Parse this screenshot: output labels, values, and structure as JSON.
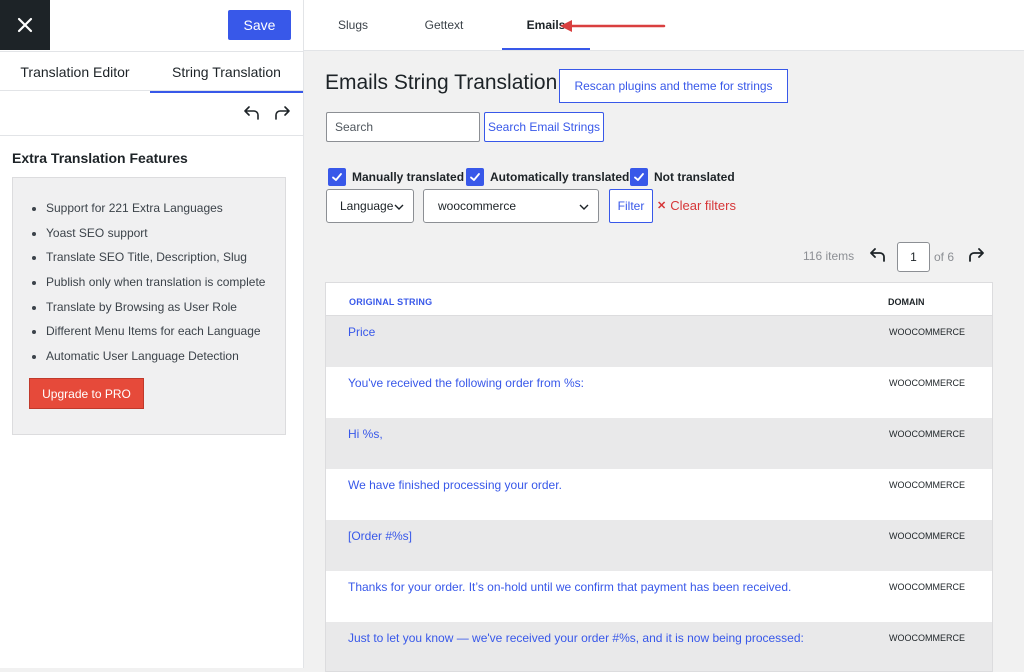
{
  "sidebar": {
    "save_label": "Save",
    "tabs": [
      {
        "label": "Translation Editor",
        "active": false
      },
      {
        "label": "String Translation",
        "active": true
      }
    ],
    "features_title": "Extra Translation Features",
    "features": [
      "Support for 221 Extra Languages",
      "Yoast SEO support",
      "Translate SEO Title, Description, Slug",
      "Publish only when translation is complete",
      "Translate by Browsing as User Role",
      "Different Menu Items for each Language",
      "Automatic User Language Detection"
    ],
    "upgrade_label": "Upgrade to PRO"
  },
  "topbar": {
    "tabs": [
      {
        "label": "Slugs",
        "active": false
      },
      {
        "label": "Gettext",
        "active": false
      },
      {
        "label": "Emails",
        "active": true
      }
    ]
  },
  "main": {
    "title": "Emails String Translation",
    "rescan_label": "Rescan plugins and theme for strings",
    "search_placeholder": "Search",
    "search_button": "Search Email Strings",
    "checkboxes": [
      {
        "label": "Manually translated",
        "checked": true
      },
      {
        "label": "Automatically translated",
        "checked": true
      },
      {
        "label": "Not translated",
        "checked": true
      }
    ],
    "language_select": "Language",
    "domain_select": "woocommerce",
    "filter_label": "Filter",
    "clear_filters": "Clear filters",
    "items_count": "116 items",
    "page_current": "1",
    "page_of": "of 6"
  },
  "table": {
    "headers": {
      "original": "ORIGINAL STRING",
      "domain": "DOMAIN"
    },
    "rows": [
      {
        "original": "Price",
        "domain": "WOOCOMMERCE"
      },
      {
        "original": "You've received the following order from %s:",
        "domain": "WOOCOMMERCE"
      },
      {
        "original": "Hi %s,",
        "domain": "WOOCOMMERCE"
      },
      {
        "original": "We have finished processing your order.",
        "domain": "WOOCOMMERCE"
      },
      {
        "original": "[Order #%s]",
        "domain": "WOOCOMMERCE"
      },
      {
        "original": "Thanks for your order. It’s on-hold until we confirm that payment has been received.",
        "domain": "WOOCOMMERCE"
      },
      {
        "original": "Just to let you know — we've received your order #%s, and it is now being processed:",
        "domain": "WOOCOMMERCE"
      }
    ]
  },
  "colors": {
    "accent": "#3858e9",
    "danger": "#d63638",
    "upgrade": "#e64a3a",
    "annotation_arrow": "#d93f3f"
  },
  "icons": [
    "close-icon",
    "undo-icon",
    "redo-icon",
    "checkmark-icon",
    "chevron-down-icon",
    "clear-x-icon",
    "annotation-arrow"
  ]
}
